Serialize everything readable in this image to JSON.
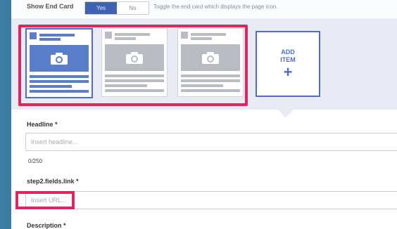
{
  "settings": {
    "end_card_label": "Show End Card",
    "toggle": [
      "Yes",
      "No"
    ],
    "help_text": "Toggle the end card which displays the page icon."
  },
  "add_item": {
    "line1": "ADD",
    "line2": "ITEM",
    "plus": "+"
  },
  "form": {
    "headline_label": "Headline *",
    "headline_placeholder": "Insert headline...",
    "headline_counter": "0/250",
    "link_label": "step2.fields.link *",
    "link_placeholder": "Insert URL...",
    "description_label": "Description *"
  },
  "colors": {
    "highlight": "#e0245e",
    "accent": "#4a6fc4"
  }
}
